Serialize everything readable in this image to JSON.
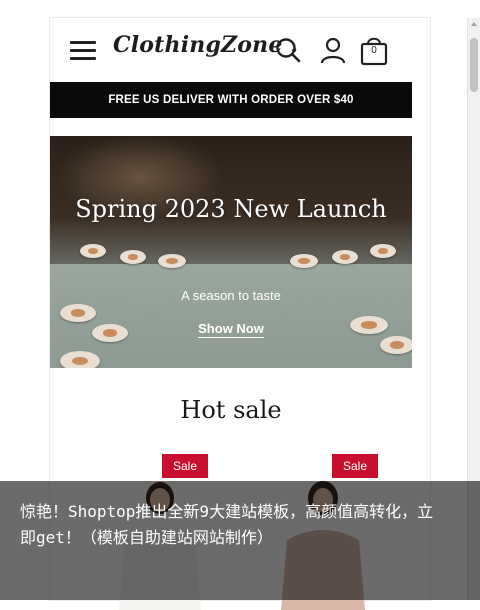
{
  "header": {
    "logo": "ClothingZone .",
    "cart_count": "0",
    "icons": [
      "menu-icon",
      "search-icon",
      "user-icon",
      "shopping-bag-icon"
    ]
  },
  "promo_bar": {
    "text": "FREE US DELIVER WITH ORDER OVER $40",
    "bg_color": "#0a0a0a"
  },
  "hero": {
    "title": "Spring 2023 New Launch",
    "subtitle": "A season to taste",
    "link": "Show Now"
  },
  "hot_sale": {
    "title": "Hot sale",
    "products": [
      {
        "badge": "Sale"
      },
      {
        "badge": "Sale"
      }
    ],
    "badge_color": "#c8102e"
  },
  "caption": {
    "text": "惊艳！Shoptop推出全新9大建站模板，高颜值高转化，立即get！（模板自助建站网站制作）"
  }
}
